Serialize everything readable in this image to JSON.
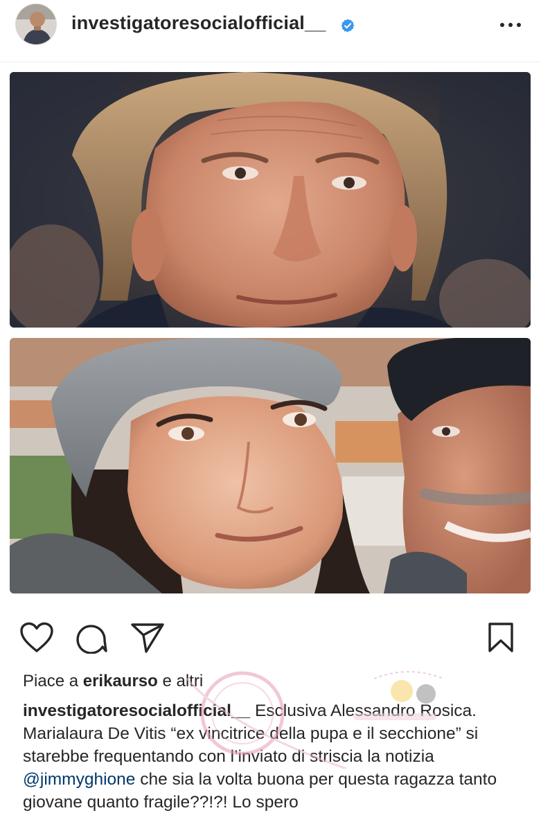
{
  "post": {
    "username": "investigatoresocialofficial__",
    "verified": true,
    "more_icon": "more-horizontal-icon",
    "avatar_icon": "profile-avatar",
    "images": [
      "post-photo-man-portrait",
      "post-photo-woman-and-man-selfie"
    ]
  },
  "actions": {
    "like_icon": "heart-icon",
    "comment_icon": "comment-icon",
    "share_icon": "paper-plane-icon",
    "save_icon": "bookmark-icon"
  },
  "likes": {
    "prefix": "Piace a",
    "user": "erikaurso",
    "suffix": "e altri"
  },
  "caption": {
    "username": "investigatoresocialofficial__",
    "text_before": "Esclusiva Alessandro Rosica. Marialaura De Vitis “ex vincitrice della pupa e il secchione” si starebbe frequentando con l’inviato di striscia la notizia",
    "mention": "@jimmyghione",
    "text_after": "che sia la volta buona per questa ragazza tanto giovane quanto fragile??!?! Lo spero"
  },
  "colors": {
    "text": "#262626",
    "verified_blue": "#3897f0",
    "mention": "#00376b",
    "watermark_pink": "#e89bb8"
  }
}
